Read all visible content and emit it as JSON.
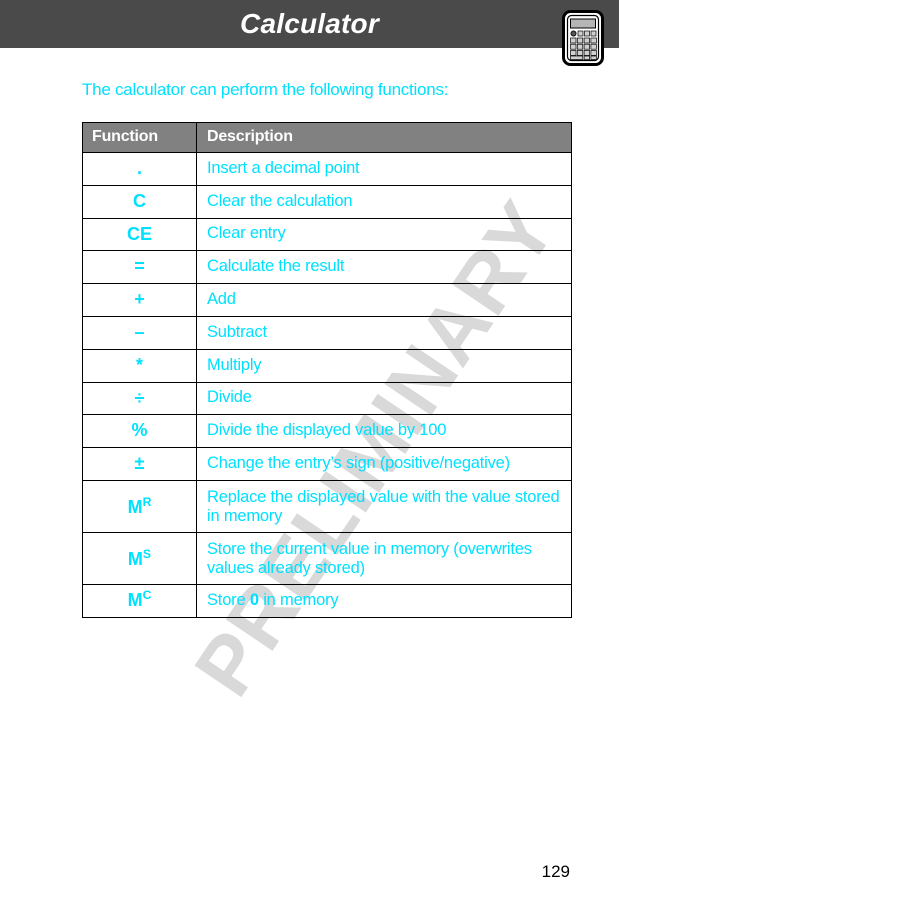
{
  "header": {
    "title": "Calculator",
    "icon": "calculator-icon",
    "bar_color": "#4a4a4a",
    "title_color": "#ffffff"
  },
  "intro": {
    "text": "The calculator can perform the following functions:",
    "color": "#00e0ff"
  },
  "watermark": {
    "text": "PRELIMINARY",
    "color": "#d9d9d9"
  },
  "table": {
    "header": {
      "function": "Function",
      "description": "Description",
      "background": "#818181",
      "text_color": "#ffffff"
    },
    "accent_color": "#00e0ff",
    "rows": [
      {
        "function": ".",
        "sup": "",
        "description": "Insert a decimal point",
        "tall": false
      },
      {
        "function": "C",
        "sup": "",
        "description": "Clear the calculation",
        "tall": false
      },
      {
        "function": "CE",
        "sup": "",
        "description": "Clear entry",
        "tall": false
      },
      {
        "function": "=",
        "sup": "",
        "description": "Calculate the result",
        "tall": false
      },
      {
        "function": "+",
        "sup": "",
        "description": "Add",
        "tall": false
      },
      {
        "function": "–",
        "sup": "",
        "description": "Subtract",
        "tall": false
      },
      {
        "function": "*",
        "sup": "",
        "description": "Multiply",
        "tall": false
      },
      {
        "function": "÷",
        "sup": "",
        "description": "Divide",
        "tall": false
      },
      {
        "function": "%",
        "sup": "",
        "description": "Divide the displayed value by 100",
        "tall": false
      },
      {
        "function": "±",
        "sup": "",
        "description": "Change the entry’s sign (positive/negative)",
        "tall": false
      },
      {
        "function": "M",
        "sup": "R",
        "description": "Replace the displayed value with the value stored in memory",
        "tall": true
      },
      {
        "function": "M",
        "sup": "S",
        "description": "Store the current value in memory (overwrites values already stored)",
        "tall": true
      },
      {
        "function": "M",
        "sup": "C",
        "description_pre": "Store ",
        "description_bold": "0",
        "description_post": " in memory",
        "description": "Store 0 in memory",
        "tall": false
      }
    ]
  },
  "footer": {
    "page_number": "129"
  }
}
